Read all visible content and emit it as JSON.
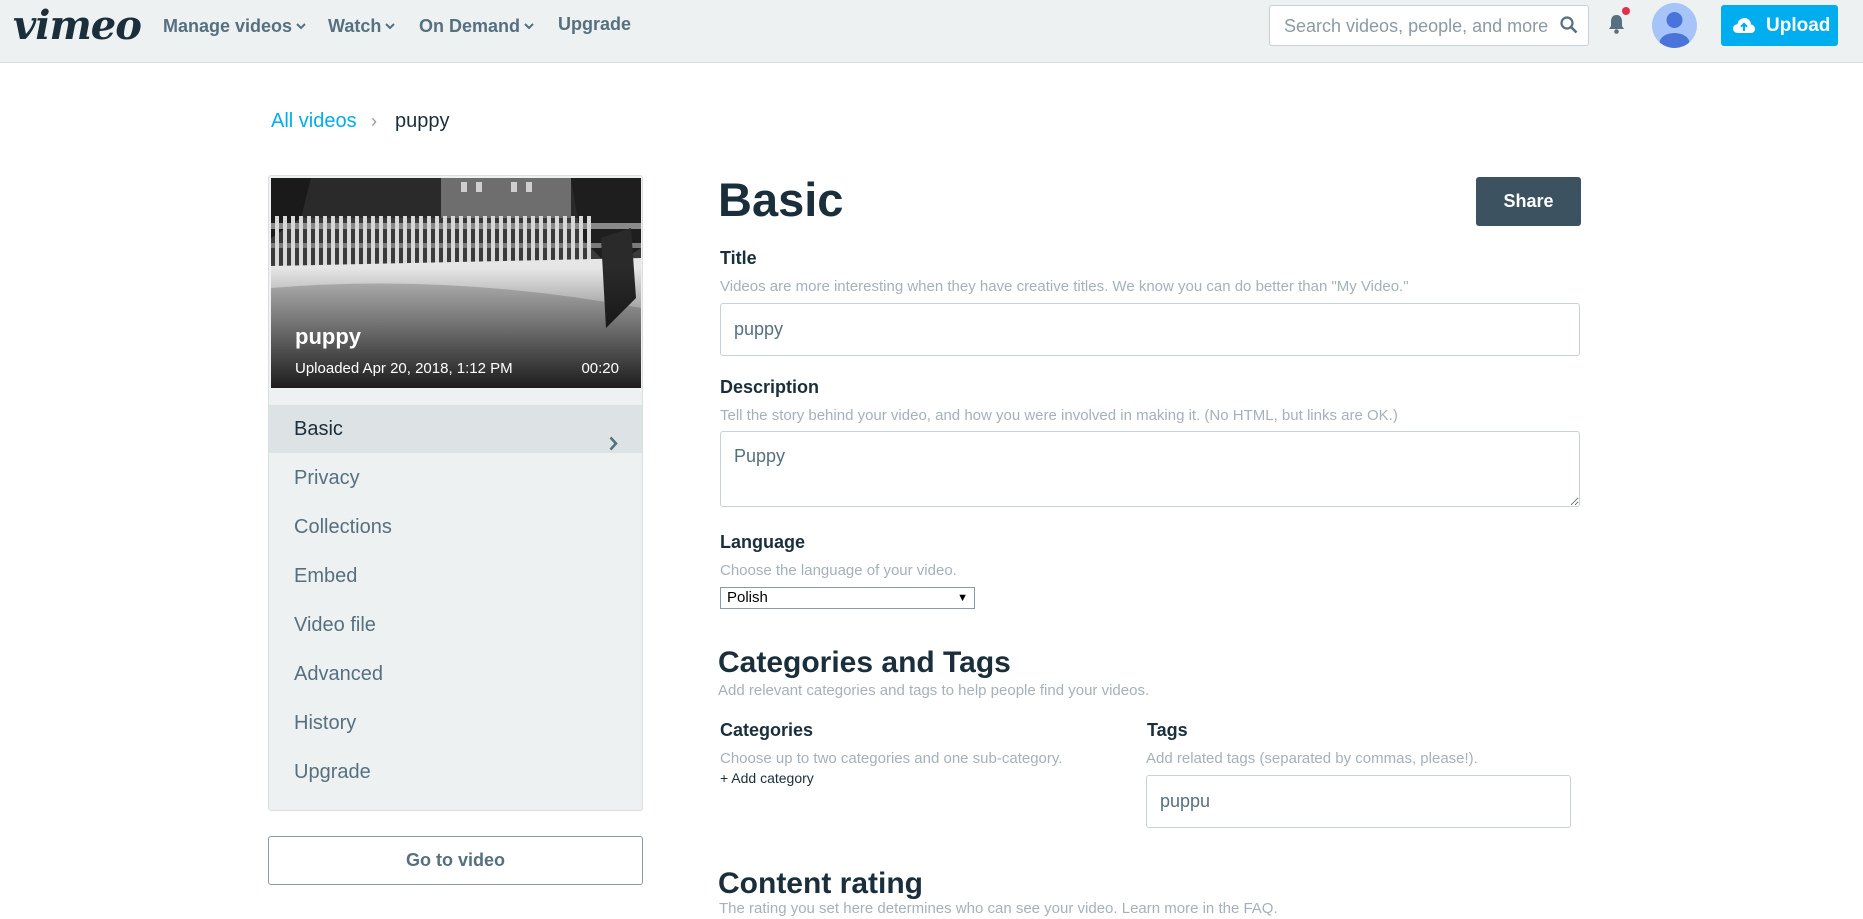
{
  "nav": {
    "logo": "vimeo",
    "items": [
      {
        "label": "Manage videos",
        "has_menu": true
      },
      {
        "label": "Watch",
        "has_menu": true
      },
      {
        "label": "On Demand",
        "has_menu": true
      },
      {
        "label": "Upgrade",
        "has_menu": false
      }
    ],
    "search_placeholder": "Search videos, people, and more",
    "upload_label": "Upload",
    "accent_color": "#00adef"
  },
  "breadcrumb": {
    "link": "All videos",
    "separator": "›",
    "current": "puppy"
  },
  "video": {
    "title": "puppy",
    "uploaded": "Uploaded Apr 20, 2018, 1:12 PM",
    "duration": "00:20"
  },
  "sidebar": {
    "items": [
      {
        "label": "Basic",
        "active": true
      },
      {
        "label": "Privacy",
        "active": false
      },
      {
        "label": "Collections",
        "active": false
      },
      {
        "label": "Embed",
        "active": false
      },
      {
        "label": "Video file",
        "active": false
      },
      {
        "label": "Advanced",
        "active": false
      },
      {
        "label": "History",
        "active": false
      },
      {
        "label": "Upgrade",
        "active": false
      }
    ],
    "go_to_video": "Go to video"
  },
  "main": {
    "heading": "Basic",
    "share_label": "Share",
    "title_label": "Title",
    "title_hint": "Videos are more interesting when they have creative titles. We know you can do better than \"My Video.\"",
    "title_value": "puppy",
    "description_label": "Description",
    "description_hint": "Tell the story behind your video, and how you were involved in making it. (No HTML, but links are OK.)",
    "description_value": "Puppy",
    "language_label": "Language",
    "language_hint": "Choose the language of your video.",
    "language_value": "Polish",
    "cat_heading": "Categories and Tags",
    "cat_hint": "Add relevant categories and tags to help people find your videos.",
    "categories_label": "Categories",
    "categories_hint": "Choose up to two categories and one sub-category.",
    "add_category": "+ Add category",
    "tags_label": "Tags",
    "tags_hint": "Add related tags (separated by commas, please!).",
    "tags_value": "puppu",
    "rating_heading": "Content rating",
    "rating_hint": "The rating you set here determines who can see your video. Learn more in the FAQ."
  }
}
